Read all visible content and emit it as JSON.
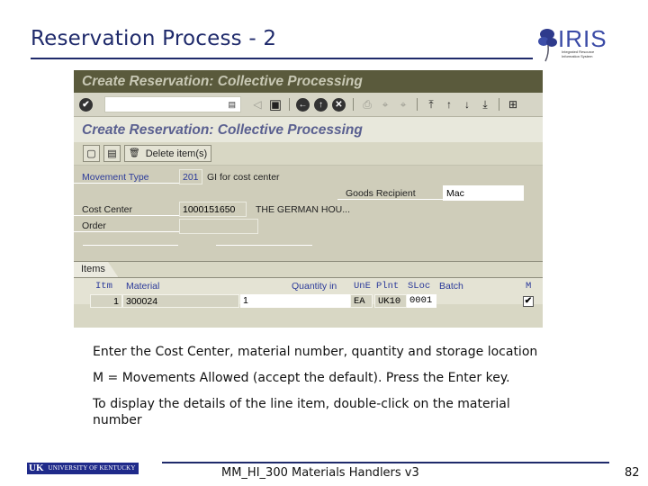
{
  "slide": {
    "title": "Reservation Process - 2",
    "logo": {
      "name": "IRIS",
      "subtitle": "Integrated Resource Information System"
    },
    "notes": [
      "Enter the Cost Center, material number, quantity and storage location",
      "M = Movements Allowed (accept the default). Press the Enter key.",
      "To display the details of the line item, double-click on the material number"
    ],
    "footer": {
      "university_mark": "UK",
      "university_name": "UNIVERSITY OF KENTUCKY",
      "course": "MM_HI_300 Materials Handlers v3",
      "page": "82"
    }
  },
  "sap": {
    "window_title": "Create Reservation: Collective Processing",
    "screen_title": "Create Reservation: Collective Processing",
    "command_field": {
      "value": "",
      "placeholder": ""
    },
    "toolbar_icons": {
      "enter": "✔",
      "dropdown": "▤",
      "back_arrow": "◁",
      "save": "▣",
      "back": "←",
      "exit": "↑",
      "cancel": "✕",
      "print": "⎙",
      "find": "⌖",
      "find_next": "⌖",
      "first_page": "⤒",
      "prev_page": "↑",
      "next_page": "↓",
      "last_page": "⤓",
      "layout": "⊞"
    },
    "app_toolbar": {
      "new_icon": "▢",
      "detail_icon": "▤",
      "delete_icon": "🗑",
      "delete_label": "Delete item(s)"
    },
    "header": {
      "movement_type_label": "Movement Type",
      "movement_type_value": "201",
      "movement_type_text": "GI for cost center",
      "goods_recipient_label": "Goods Recipient",
      "goods_recipient_value": "Mac",
      "cost_center_label": "Cost Center",
      "cost_center_value": "1000151650",
      "cost_center_text": "THE GERMAN HOU...",
      "order_label": "Order",
      "order_value": ""
    },
    "items_tab": "Items",
    "items": {
      "columns": [
        "Itm",
        "Material",
        "Quantity in",
        "UnE",
        "Plnt",
        "SLoc",
        "Batch",
        "M"
      ],
      "rows": [
        {
          "itm": "1",
          "material": "300024",
          "quantity": "1",
          "unit": "EA",
          "plant": "UK10",
          "sloc": "0001",
          "batch": "",
          "movement_allowed": true,
          "check_glyph": "✔"
        }
      ]
    }
  }
}
